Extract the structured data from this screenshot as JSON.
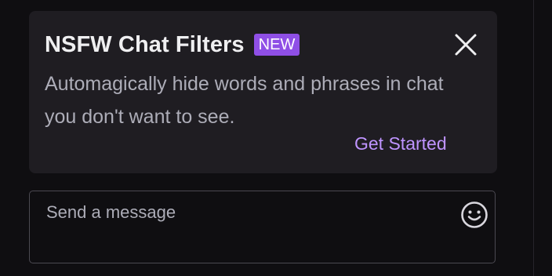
{
  "promo_card": {
    "title": "NSFW Chat Filters",
    "badge": "NEW",
    "description": "Automagically hide words and phrases in chat you don't want to see.",
    "cta": "Get Started",
    "close_icon": "close-icon"
  },
  "chat_input": {
    "placeholder": "Send a message",
    "emoji_icon": "smiley-emoji-icon"
  },
  "colors": {
    "background": "#0f0e11",
    "card_background": "#1f1d22",
    "accent": "#bf94ff",
    "badge_background": "#8f4fe6",
    "text_primary": "#efeff1",
    "text_secondary": "#adadb8"
  }
}
